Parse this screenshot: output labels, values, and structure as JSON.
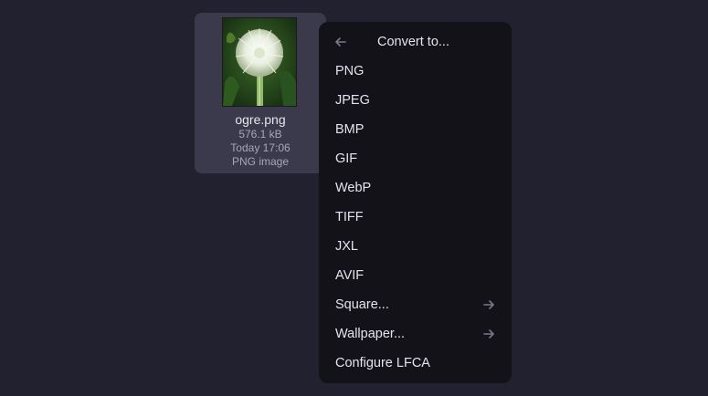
{
  "file": {
    "name": "ogre.png",
    "size": "576.1 kB",
    "modified": "Today 17:06",
    "type": "PNG image",
    "thumbnail_icon": "dandelion-seedhead-photo"
  },
  "menu": {
    "title": "Convert to...",
    "back_icon": "arrow-left-icon",
    "items": [
      {
        "label": "PNG"
      },
      {
        "label": "JPEG"
      },
      {
        "label": "BMP"
      },
      {
        "label": "GIF"
      },
      {
        "label": "WebP"
      },
      {
        "label": "TIFF"
      },
      {
        "label": "JXL"
      },
      {
        "label": "AVIF"
      },
      {
        "label": "Square...",
        "submenu_icon": "arrow-right-icon"
      },
      {
        "label": "Wallpaper...",
        "submenu_icon": "arrow-right-icon"
      },
      {
        "label": "Configure LFCA"
      }
    ]
  },
  "colors": {
    "background": "#222130",
    "tile_selected": "#3a3a4c",
    "menu_background": "#131219",
    "text_primary": "#e4e4ec",
    "text_secondary": "#a6a6b4",
    "icon_muted": "#7a7a88"
  }
}
